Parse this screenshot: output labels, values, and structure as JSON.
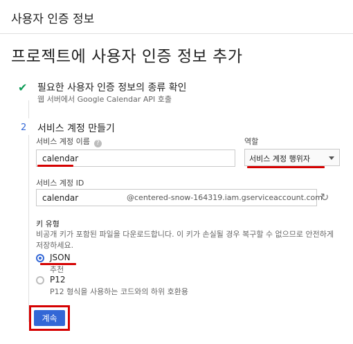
{
  "header": {
    "title": "사용자 인증 정보"
  },
  "page_title": "프로젝트에 사용자 인증 정보 추가",
  "step1": {
    "title": "필요한 사용자 인증 정보의 종류 확인",
    "desc": "웹 서버에서 Google Calendar API 호출"
  },
  "step2": {
    "number": "2",
    "title": "서비스 계정 만들기",
    "name_label": "서비스 계정 이름",
    "name_value": "calendar",
    "role_label": "역할",
    "role_value": "서비스 계정 행위자",
    "id_label": "서비스 계정 ID",
    "id_local": "calendar",
    "id_domain": "@centered-snow-164319.iam.gserviceaccount.com",
    "key_type_label": "키 유형",
    "key_desc": "비공개 키가 포함된 파일을 다운로드합니다. 이 키가 손실될 경우 복구할 수 없으므로 안전하게 저장하세요.",
    "options": [
      {
        "label": "JSON",
        "sub": "추천",
        "selected": true
      },
      {
        "label": "P12",
        "sub": "P12 형식을 사용하는 코드와의 하위 호환용",
        "selected": false
      }
    ],
    "continue_label": "계속"
  },
  "colors": {
    "accent": "#3367d6",
    "highlight": "#d50000",
    "check": "#0f9d58"
  },
  "icons": [
    "check-icon",
    "help-icon",
    "dropdown-arrow-icon",
    "refresh-icon"
  ]
}
